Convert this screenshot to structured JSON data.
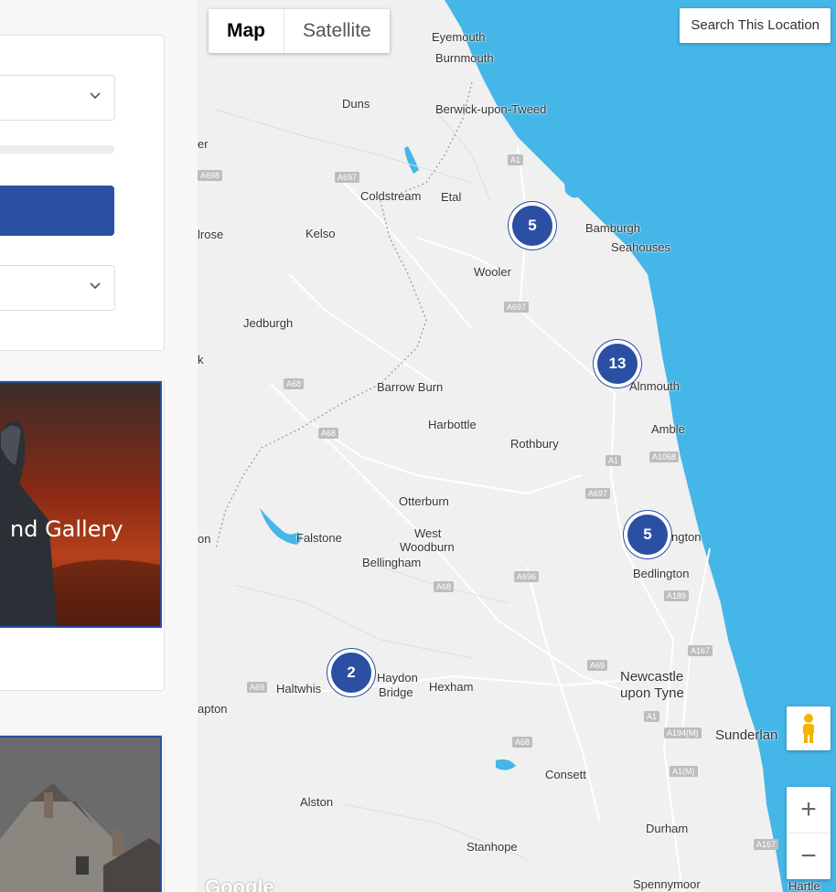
{
  "left_panel": {
    "card1_title": "nd Gallery"
  },
  "map": {
    "map_type": {
      "map_label": "Map",
      "satellite_label": "Satellite"
    },
    "search_button": "Search This Location",
    "zoom_in": "+",
    "zoom_out": "−",
    "google_logo": "Google",
    "clusters": [
      {
        "count": "5"
      },
      {
        "count": "13"
      },
      {
        "count": "5"
      },
      {
        "count": "2"
      }
    ],
    "places": {
      "eyemouth": "Eyemouth",
      "burnmouth": "Burnmouth",
      "duns": "Duns",
      "berwick": "Berwick-upon-Tweed",
      "er": "er",
      "coldstream": "Coldstream",
      "etal": "Etal",
      "bamburgh": "Bamburgh",
      "seahouses": "Seahouses",
      "lrose": "lrose",
      "kelso": "Kelso",
      "wooler": "Wooler",
      "jedburgh": "Jedburgh",
      "barrow_burn": "Barrow Burn",
      "alnmouth": "Alnmouth",
      "harbottle": "Harbottle",
      "amble": "Amble",
      "rothbury": "Rothbury",
      "otterburn": "Otterburn",
      "west_woodburn_1": "West",
      "west_woodburn_2": "Woodburn",
      "falstone": "Falstone",
      "bellingham": "Bellingham",
      "ngton": "ngton",
      "bedlington": "Bedlington",
      "haydon_1": "Haydon",
      "haydon_2": "Bridge",
      "haltwhis": "Haltwhis",
      "hexham": "Hexham",
      "newcastle_1": "Newcastle",
      "newcastle_2": "upon Tyne",
      "apton": "apton",
      "sunderland": "Sunderlan",
      "consett": "Consett",
      "alston": "Alston",
      "durham": "Durham",
      "stanhope": "Stanhope",
      "spennymoor": "Spennymoor",
      "hartle": "Hartle",
      "k": "k",
      "on": "on"
    },
    "roads": {
      "a1_north": "A1",
      "a697": "A697",
      "a698": "A698",
      "a68": "A68",
      "a1068": "A1068",
      "a1_mid": "A1",
      "a697b": "A697",
      "a696": "A696",
      "a189": "A189",
      "a69": "A69",
      "a68b": "A68",
      "a194m": "A194(M)",
      "a1m": "A1(M)",
      "a1_south": "A1",
      "a68c": "A68",
      "a167": "A167"
    }
  },
  "colors": {
    "sea": "#45b6e8",
    "land": "#f0f0f0",
    "accent": "#2a4fa3"
  }
}
